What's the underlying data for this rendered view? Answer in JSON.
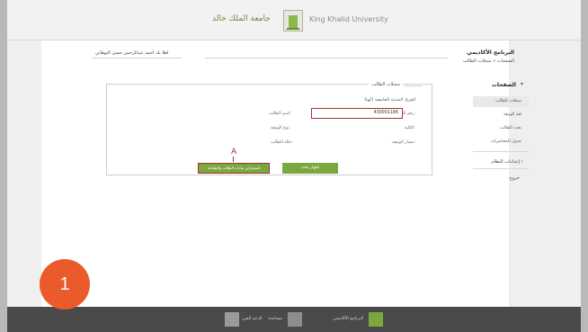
{
  "header": {
    "logo_arabic": "جامعة الملك خالد",
    "logo_english": "King Khalid University"
  },
  "page": {
    "title": "البرنامج الأكاديمي",
    "breadcrumb": "الصفحات » سجلات الطالب",
    "user_name": "اهلا بك احمد عبدالرحمن حسن البوهاني"
  },
  "sidebar": {
    "heading": "الصفحات",
    "items": [
      {
        "label": "سجلات الطالب",
        "active": true
      },
      {
        "label": "لغة الوثيقة",
        "active": false
      },
      {
        "label": "بحث الطالب",
        "active": false
      },
      {
        "label": "جدول المحاضرات",
        "active": false
      }
    ],
    "section2": "إعدادات النظام",
    "section3": "خروج"
  },
  "form": {
    "legend": "سجلات الطالب",
    "university": "الفرع: المدينة الجامعية (أبها)",
    "student_id_label": "رقم الطالب:",
    "student_id_value": "430001186",
    "student_name_label": "اسم الطالب:",
    "college_label": "الكلية:",
    "doc_type_label": "نوع الوثيقة:",
    "major_label": "مسار الوثيقة:",
    "status_label": "حالة الطالب:",
    "view_button": "اظهار بحث",
    "verify_button": "استعراض بيانات الطالب والطباعة"
  },
  "marker": "A",
  "step_number": "1",
  "footer": {
    "items": [
      {
        "label": "البرنامج الأكاديمي"
      },
      {
        "label": "مساعدة"
      },
      {
        "label": "الدعم الفني"
      }
    ]
  }
}
